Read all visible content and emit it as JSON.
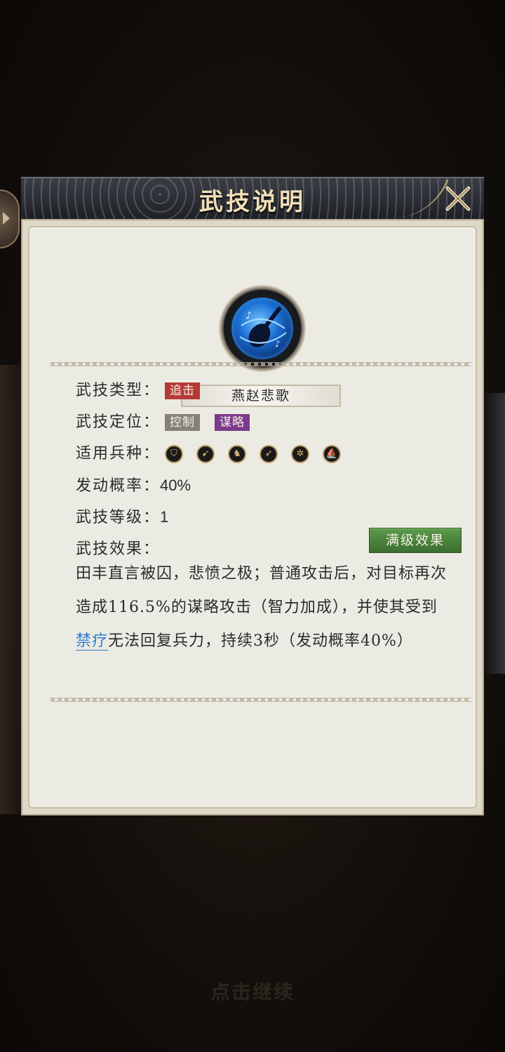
{
  "dialog": {
    "title": "武技说明",
    "skill_name": "燕赵悲歌",
    "type_label": "武技类型：",
    "type_tag": "追击",
    "position_label": "武技定位：",
    "position_tags": [
      "控制",
      "谋略"
    ],
    "troops_label": "适用兵种：",
    "troops": [
      "shield-icon",
      "spear-icon",
      "cavalry-icon",
      "bow-icon",
      "wheel-icon",
      "ship-icon"
    ],
    "rate_label": "发动概率：",
    "rate_value": "40%",
    "level_label": "武技等级：",
    "level_value": "1",
    "effect_label": "武技效果：",
    "full_level_button": "满级效果",
    "effect_part1": "田丰直言被囚，悲愤之极；普通攻击后，对目标再次造成116.5%的谋略攻击（智力加成）",
    "effect_part2": "，并使其受到",
    "effect_keyword": "禁疗",
    "effect_part3": "无法回复兵力，持续3秒（发动概率40%）"
  },
  "footer": {
    "continue_text": "点击继续"
  },
  "colors": {
    "tag_red": "#b53a36",
    "tag_gray": "#86807a",
    "tag_purple": "#7b3a8c",
    "button_green": "#4a8a3a",
    "keyword_blue": "#2f7bcf"
  }
}
